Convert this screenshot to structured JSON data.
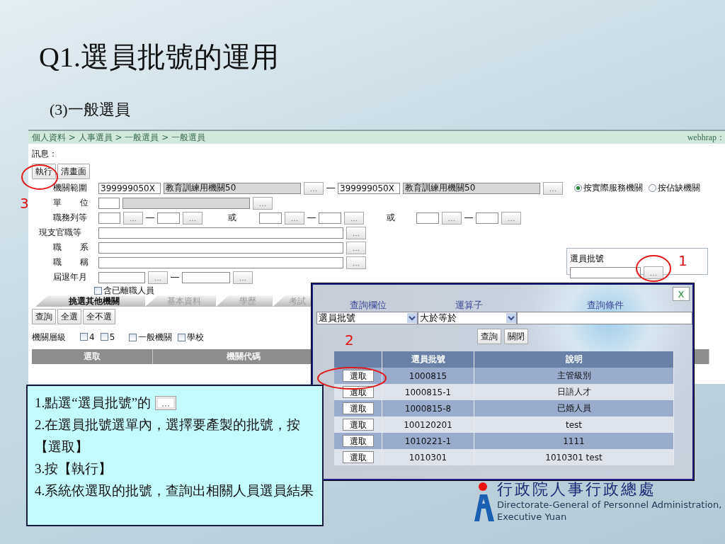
{
  "slide": {
    "title": "Q1.選員批號的運用",
    "subtitle": "(3)一般選員"
  },
  "page": {
    "breadcrumb": "個人資料 > 人事選員 > 一般選員 > 一般選員",
    "user": "webhrap：",
    "message_label": "訊息：",
    "buttons": [
      "執行",
      "清畫面"
    ],
    "org_range": {
      "label": "機關範圍",
      "from_code": "399999050X",
      "from_name": "教育訓練用機關50",
      "to_code": "399999050X",
      "to_name": "教育訓練用機關50"
    },
    "radio_options": [
      {
        "label": "按實際服務機關",
        "selected": true
      },
      {
        "label": "按佔缺機關",
        "selected": false
      }
    ],
    "unit": {
      "label": "單位"
    },
    "grade": {
      "label": "職務列等",
      "or_labels": [
        "或",
        "或"
      ]
    },
    "wide_rows": [
      {
        "label": "現支官職等"
      },
      {
        "label": "職系"
      },
      {
        "label": "職稱"
      }
    ],
    "retire": {
      "label": "屆退年月"
    },
    "include_left": {
      "label": "含已離職人員",
      "checked": false
    },
    "batch": {
      "label": "選員批號"
    },
    "tabs": [
      {
        "label": "挑選其他機關",
        "selected": true
      },
      {
        "label": "基本資料",
        "selected": false
      },
      {
        "label": "學歷",
        "selected": false
      },
      {
        "label": "考試",
        "selected": false
      }
    ],
    "actions": [
      "查詢",
      "全選",
      "全不選"
    ],
    "level_filter": {
      "label": "機關層級",
      "options": [
        {
          "label": "4",
          "checked": false
        },
        {
          "label": "5",
          "checked": false
        },
        {
          "label": "一般機關",
          "checked": false
        },
        {
          "label": "學校",
          "checked": false
        }
      ]
    },
    "table": {
      "columns": [
        "選取",
        "機關代碼"
      ]
    }
  },
  "popup": {
    "close": "X",
    "field_labels": [
      "查詢欄位",
      "運算子",
      "查詢條件"
    ],
    "field_select": "選員批號",
    "operator_select": "大於等於",
    "buttons": [
      "查詢",
      "關閉"
    ],
    "columns": [
      "選員批號",
      "說明"
    ],
    "rows": [
      {
        "action": "選取",
        "code": "1000815",
        "note": "主管級別"
      },
      {
        "action": "選取",
        "code": "1000815-1",
        "note": "日語人才"
      },
      {
        "action": "選取",
        "code": "1000815-8",
        "note": "已婚人員"
      },
      {
        "action": "選取",
        "code": "100120201",
        "note": "test"
      },
      {
        "action": "選取",
        "code": "1010221-1",
        "note": "1111"
      },
      {
        "action": "選取",
        "code": "1010301",
        "note": "1010301 test"
      }
    ]
  },
  "markers": [
    {
      "label": "3"
    },
    {
      "label": "1"
    },
    {
      "label": "2"
    }
  ],
  "instructions": [
    {
      "kind": "with-button",
      "text": "1.點選“選員批號”的"
    },
    {
      "kind": "plain",
      "text": "2.在選員批號選單內，選擇要產製的批號，按【選取】"
    },
    {
      "kind": "plain",
      "text": "3.按【執行】"
    },
    {
      "kind": "plain",
      "text": "4.系統依選取的批號，查詢出相關人員選員結果"
    }
  ],
  "logo": {
    "name": "行政院人事行政總處",
    "english_line_1": "Directorate-General of Personnel Administration,",
    "english_line_2": "Executive Yuan"
  }
}
